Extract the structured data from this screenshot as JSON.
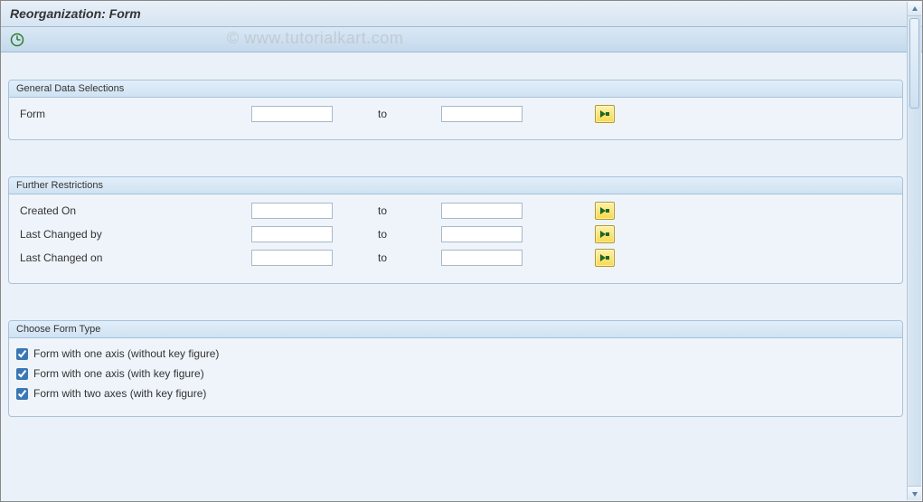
{
  "title": "Reorganization: Form",
  "watermark": "© www.tutorialkart.com",
  "groups": {
    "general": {
      "title": "General Data Selections",
      "rows": [
        {
          "label": "Form",
          "from": "",
          "to_label": "to",
          "to": ""
        }
      ]
    },
    "restrictions": {
      "title": "Further Restrictions",
      "rows": [
        {
          "label": "Created On",
          "from": "",
          "to_label": "to",
          "to": ""
        },
        {
          "label": "Last Changed by",
          "from": "",
          "to_label": "to",
          "to": ""
        },
        {
          "label": "Last Changed on",
          "from": "",
          "to_label": "to",
          "to": ""
        }
      ]
    },
    "formtype": {
      "title": "Choose Form Type",
      "options": [
        {
          "label": "Form with one axis (without key figure)",
          "checked": true
        },
        {
          "label": "Form with one axis (with key figure)",
          "checked": true
        },
        {
          "label": "Form with two axes (with key figure)",
          "checked": true
        }
      ]
    }
  }
}
